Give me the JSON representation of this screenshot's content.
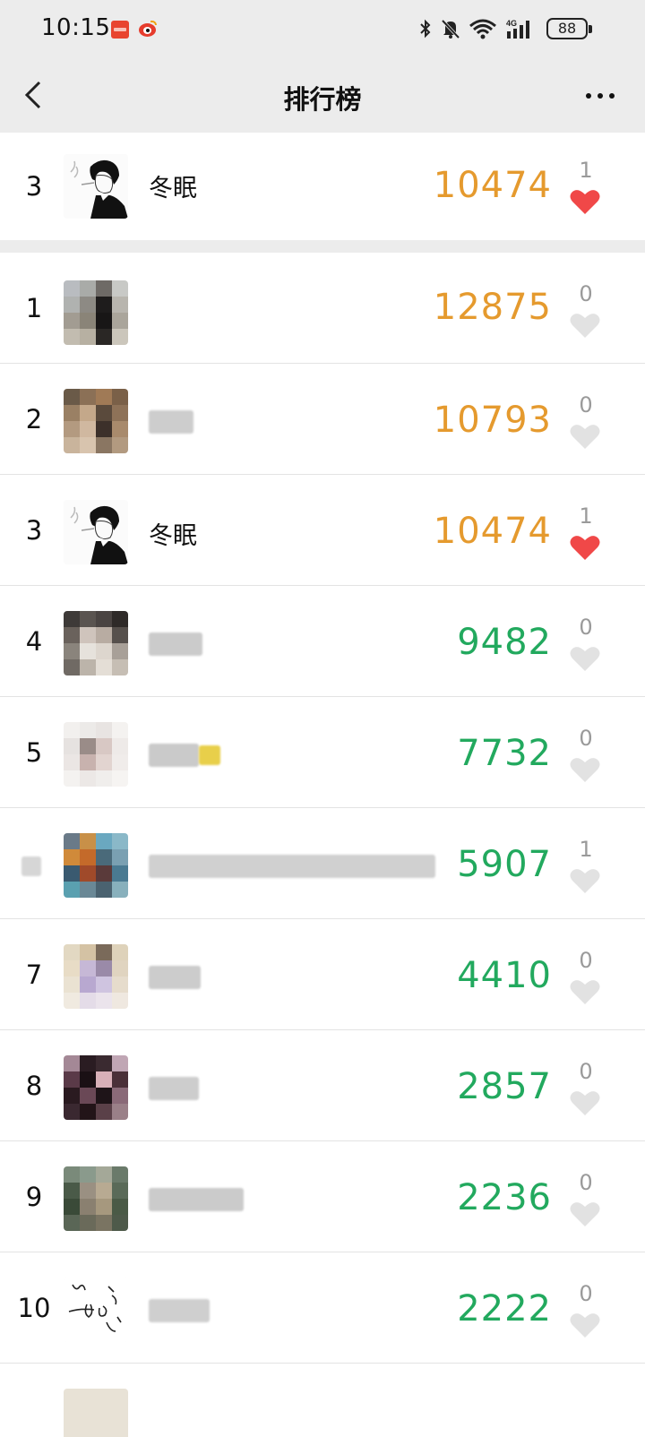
{
  "status_bar": {
    "time": "10:15",
    "battery": "88",
    "icons": [
      "bluetooth-icon",
      "mute-bell-icon",
      "wifi-icon",
      "signal-4g-icon"
    ]
  },
  "header": {
    "title": "排行榜",
    "back_icon": "chevron-left-icon",
    "more_icon": "more-dots-icon"
  },
  "colors": {
    "gold": "#e59a2e",
    "green": "#22a95e",
    "heart_liked": "#f04848",
    "heart_unliked": "#e2e2e2",
    "header_bg": "#ececec"
  },
  "my_rank": {
    "rank": "3",
    "name": "冬眠",
    "steps": "10474",
    "likes": "1",
    "liked": true
  },
  "ranking": [
    {
      "rank": "1",
      "name": "",
      "steps": "12875",
      "likes": "0",
      "liked": false,
      "color": "gold"
    },
    {
      "rank": "2",
      "name": "",
      "steps": "10793",
      "likes": "0",
      "liked": false,
      "color": "gold"
    },
    {
      "rank": "3",
      "name": "冬眠",
      "steps": "10474",
      "likes": "1",
      "liked": true,
      "color": "gold"
    },
    {
      "rank": "4",
      "name": "",
      "steps": "9482",
      "likes": "0",
      "liked": false,
      "color": "green"
    },
    {
      "rank": "5",
      "name": "",
      "steps": "7732",
      "likes": "0",
      "liked": false,
      "color": "green"
    },
    {
      "rank": "",
      "name": "",
      "steps": "5907",
      "likes": "1",
      "liked": false,
      "color": "green"
    },
    {
      "rank": "7",
      "name": "",
      "steps": "4410",
      "likes": "0",
      "liked": false,
      "color": "green"
    },
    {
      "rank": "8",
      "name": "",
      "steps": "2857",
      "likes": "0",
      "liked": false,
      "color": "green"
    },
    {
      "rank": "9",
      "name": "",
      "steps": "2236",
      "likes": "0",
      "liked": false,
      "color": "green"
    },
    {
      "rank": "10",
      "name": "",
      "steps": "2222",
      "likes": "0",
      "liked": false,
      "color": "green"
    }
  ]
}
